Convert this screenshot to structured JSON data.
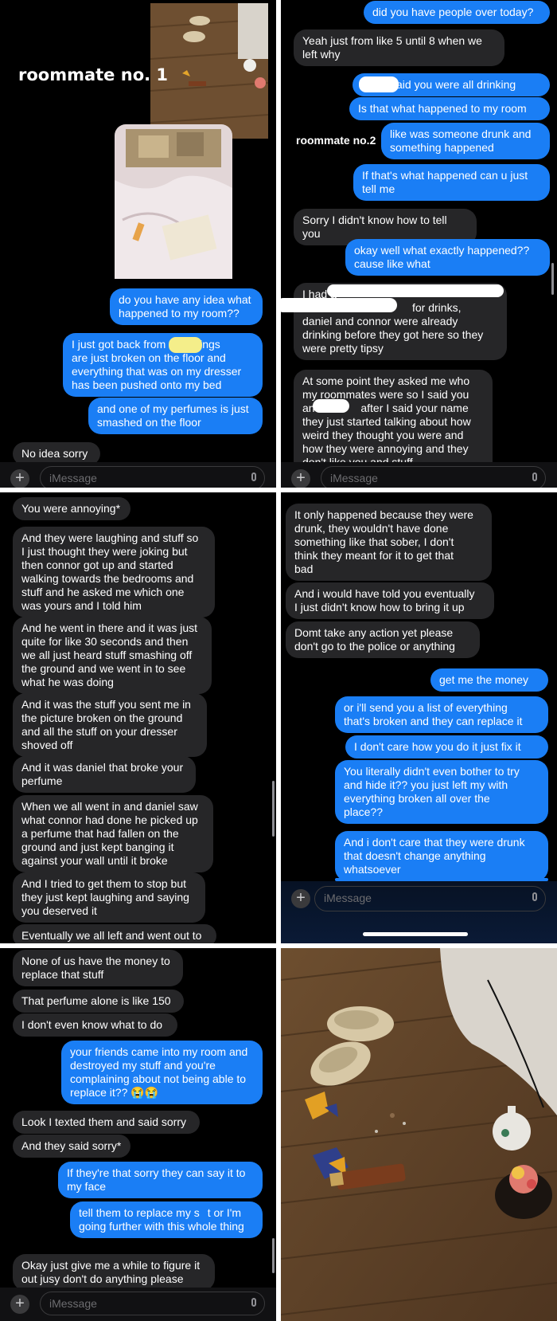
{
  "composer_placeholder": "iMessage",
  "colors": {
    "outgoing": "#1a7ef5",
    "incoming": "#262628",
    "background": "#000000",
    "redaction": "#ffffff",
    "highlight": "#f4ee8a"
  },
  "panel1": {
    "note": "roommate no. 1",
    "messages": [
      {
        "dir": "out",
        "lines": [
          "do you have any idea what",
          "happened to my room??"
        ]
      },
      {
        "dir": "out",
        "lines": [
          "I just got back from ",
          "and things",
          "are just broken on the floor and",
          "everything that was on my dresser",
          "has been pushed onto my bed"
        ]
      },
      {
        "dir": "out",
        "lines": [
          "and one of my perfumes is just",
          "smashed on the floor"
        ]
      },
      {
        "dir": "in",
        "lines": [
          "No idea sorry"
        ]
      }
    ]
  },
  "panel2": {
    "note": "roommate no.2",
    "messages": [
      {
        "dir": "out",
        "lines": [
          "did you have people over today?"
        ]
      },
      {
        "dir": "in",
        "lines": [
          "Yeah just from like 5 until 8 when we",
          "left why"
        ]
      },
      {
        "dir": "out",
        "lines": [
          "said you were all drinking"
        ]
      },
      {
        "dir": "out",
        "lines": [
          "Is that what happened to my room"
        ]
      },
      {
        "dir": "out",
        "lines": [
          "like was someone drunk and",
          "something happened"
        ]
      },
      {
        "dir": "out",
        "lines": [
          "If that's what happened can u just",
          "tell me"
        ]
      },
      {
        "dir": "in",
        "lines": [
          "Sorry I didn't know how to tell you"
        ]
      },
      {
        "dir": "out",
        "lines": [
          "okay well what exactly happened??",
          "cause like what"
        ]
      },
      {
        "dir": "in",
        "lines": [
          "I had a",
          "for drinks,",
          "daniel and connor were already",
          "drinking before they got here so they",
          "were pretty tipsy"
        ]
      },
      {
        "dir": "in",
        "lines": [
          "At some point they asked me who",
          "my roommates were so I said you",
          "and",
          "after I said your name",
          "they just started talking about how",
          "weird they thought you were and",
          "how they were annoying and they",
          "don't like you and stuff"
        ]
      }
    ]
  },
  "panel3": {
    "messages": [
      {
        "dir": "in",
        "lines": [
          "You were annoying*"
        ]
      },
      {
        "dir": "in",
        "lines": [
          "And they were laughing and stuff so",
          "I just thought they were joking but",
          "then connor got up and started",
          "walking towards the bedrooms and",
          "stuff and he asked me which one",
          "was yours and I told him"
        ]
      },
      {
        "dir": "in",
        "lines": [
          "And he went in there and it was just",
          "quite for like 30 seconds and then",
          "we all just heard stuff smashing off",
          "the ground and we went in to see",
          "what he was doing"
        ]
      },
      {
        "dir": "in",
        "lines": [
          "And it was the stuff you sent me in",
          "the picture broken on the ground",
          "and all the stuff on your dresser",
          "shoved off"
        ]
      },
      {
        "dir": "in",
        "lines": [
          "And it was daniel that broke your",
          "perfume"
        ]
      },
      {
        "dir": "in",
        "lines": [
          "When we all went in and daniel saw",
          "what connor had done he picked up",
          "a perfume that had fallen on the",
          "ground and just kept banging it",
          "against your wall until it broke"
        ]
      },
      {
        "dir": "in",
        "lines": [
          "And I tried to get them to stop but",
          "they just kept laughing and saying",
          "you deserved it"
        ]
      },
      {
        "dir": "in",
        "lines": [
          "Eventually we all left and went out to"
        ]
      }
    ]
  },
  "panel4": {
    "messages": [
      {
        "dir": "in",
        "lines": [
          "It only happened because they were",
          "drunk, they wouldn't have done",
          "something like that sober, I don't",
          "think they meant for it to get that",
          "bad"
        ]
      },
      {
        "dir": "in",
        "lines": [
          "And i would have told you eventually",
          "I just didn't know how to bring it up"
        ]
      },
      {
        "dir": "in",
        "lines": [
          "Domt take any action yet please",
          "don't go to the police or anything"
        ]
      },
      {
        "dir": "out",
        "lines": [
          "get me the money"
        ]
      },
      {
        "dir": "out",
        "lines": [
          "or i'll send you a list of everything",
          "that's broken and they can replace it"
        ]
      },
      {
        "dir": "out",
        "lines": [
          "I don't care how you do it just fix it"
        ]
      },
      {
        "dir": "out",
        "lines": [
          "You literally didn't even bother to try",
          "and hide it?? you just left my with",
          "everything broken all over the",
          "place??"
        ]
      },
      {
        "dir": "out",
        "lines": [
          "And i don't care that they were drunk",
          "that doesn't change anything",
          "whatsoever"
        ]
      }
    ]
  },
  "panel5": {
    "messages": [
      {
        "dir": "in",
        "lines": [
          "None of us have the money to",
          "replace that stuff"
        ]
      },
      {
        "dir": "in",
        "lines": [
          "That perfume alone is like 150"
        ]
      },
      {
        "dir": "in",
        "lines": [
          "I don't even know what to do"
        ]
      },
      {
        "dir": "out",
        "lines": [
          "your friends came into my room and",
          "destroyed my stuff and you're",
          "complaining about not being able to",
          "replace it?? 😭😭"
        ]
      },
      {
        "dir": "in",
        "lines": [
          "Look I texted them and said sorry"
        ]
      },
      {
        "dir": "in",
        "lines": [
          "And they said sorry*"
        ]
      },
      {
        "dir": "out",
        "lines": [
          "If they're that sorry they can say it to",
          "my face"
        ]
      },
      {
        "dir": "out",
        "lines": [
          "tell them to replace my s",
          "t or I'm",
          "going further with this whole thing"
        ]
      },
      {
        "dir": "in",
        "lines": [
          "Okay just give me a while to figure it",
          "out jusy don't do anything please"
        ]
      }
    ]
  }
}
